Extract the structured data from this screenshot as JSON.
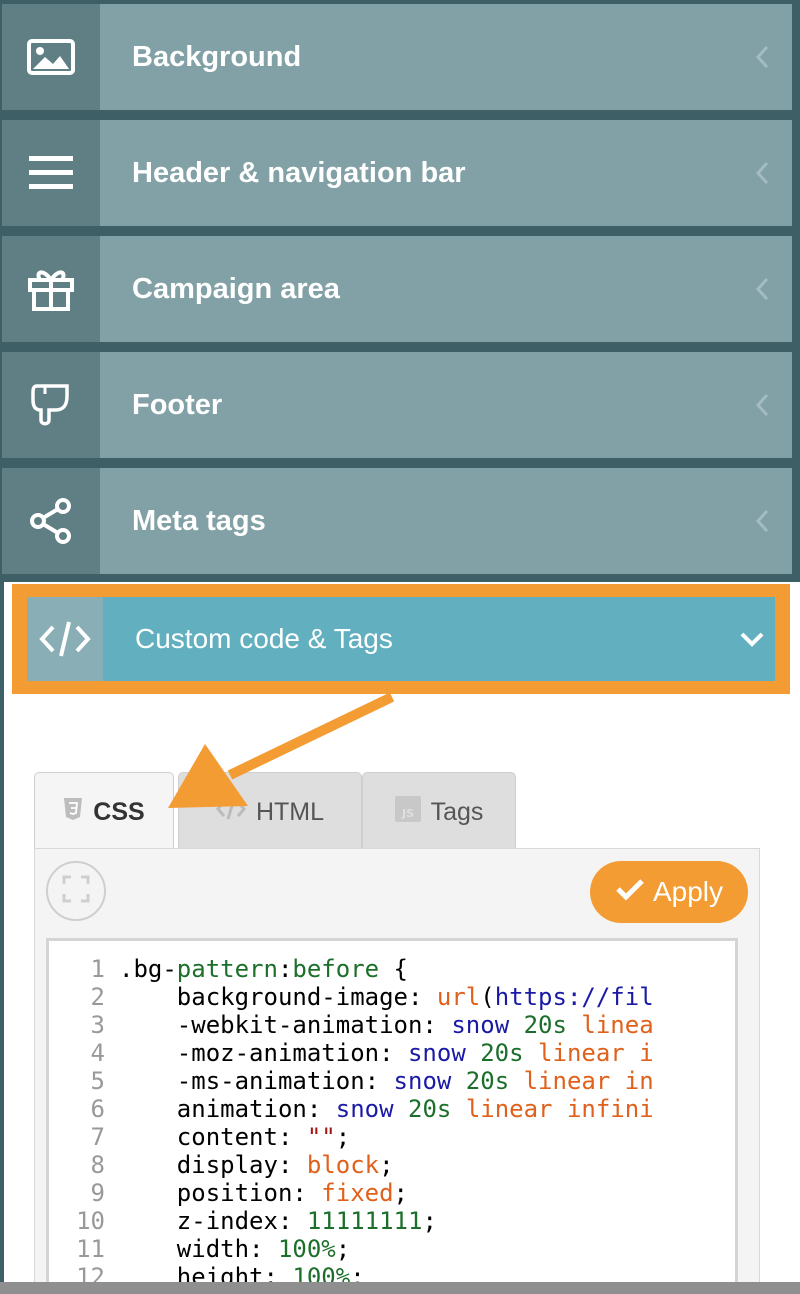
{
  "menu": [
    {
      "label": "Background",
      "icon": "image-icon"
    },
    {
      "label": "Header & navigation bar",
      "icon": "hamburger-icon"
    },
    {
      "label": "Campaign area",
      "icon": "gift-icon"
    },
    {
      "label": "Footer",
      "icon": "pointing-hand-icon"
    },
    {
      "label": "Meta tags",
      "icon": "share-icon"
    }
  ],
  "active": {
    "label": "Custom code & Tags",
    "icon": "code-icon"
  },
  "tabs": {
    "css": "CSS",
    "html": "HTML",
    "tags": "Tags"
  },
  "apply_label": "Apply",
  "code_lines": [
    {
      "n": "1",
      "parts": [
        [
          ".bg-",
          "k"
        ],
        [
          "pattern",
          "a"
        ],
        [
          ":",
          "k"
        ],
        [
          "before",
          "a"
        ],
        [
          " {",
          "k"
        ]
      ]
    },
    {
      "n": "2",
      "parts": [
        [
          "    background-image: ",
          "k"
        ],
        [
          "url",
          "o"
        ],
        [
          "(",
          "k"
        ],
        [
          "https",
          "v"
        ],
        [
          "://fil",
          "v"
        ]
      ]
    },
    {
      "n": "3",
      "parts": [
        [
          "    -webkit-animation: ",
          "k"
        ],
        [
          "snow",
          "v"
        ],
        [
          " ",
          "k"
        ],
        [
          "20s",
          "n"
        ],
        [
          " ",
          "k"
        ],
        [
          "linea",
          "o"
        ]
      ]
    },
    {
      "n": "4",
      "parts": [
        [
          "    -moz-animation: ",
          "k"
        ],
        [
          "snow",
          "v"
        ],
        [
          " ",
          "k"
        ],
        [
          "20s",
          "n"
        ],
        [
          " ",
          "k"
        ],
        [
          "linear i",
          "o"
        ]
      ]
    },
    {
      "n": "5",
      "parts": [
        [
          "    -ms-animation: ",
          "k"
        ],
        [
          "snow",
          "v"
        ],
        [
          " ",
          "k"
        ],
        [
          "20s",
          "n"
        ],
        [
          " ",
          "k"
        ],
        [
          "linear in",
          "o"
        ]
      ]
    },
    {
      "n": "6",
      "parts": [
        [
          "    animation: ",
          "k"
        ],
        [
          "snow",
          "v"
        ],
        [
          " ",
          "k"
        ],
        [
          "20s",
          "n"
        ],
        [
          " ",
          "k"
        ],
        [
          "linear infini",
          "o"
        ]
      ]
    },
    {
      "n": "7",
      "parts": [
        [
          "    content: ",
          "k"
        ],
        [
          "\"\"",
          "s"
        ],
        [
          ";",
          "k"
        ]
      ]
    },
    {
      "n": "8",
      "parts": [
        [
          "    display: ",
          "k"
        ],
        [
          "block",
          "o"
        ],
        [
          ";",
          "k"
        ]
      ]
    },
    {
      "n": "9",
      "parts": [
        [
          "    position: ",
          "k"
        ],
        [
          "fixed",
          "o"
        ],
        [
          ";",
          "k"
        ]
      ]
    },
    {
      "n": "10",
      "parts": [
        [
          "    z-index: ",
          "k"
        ],
        [
          "11111111",
          "n"
        ],
        [
          ";",
          "k"
        ]
      ]
    },
    {
      "n": "11",
      "parts": [
        [
          "    width: ",
          "k"
        ],
        [
          "100%",
          "n"
        ],
        [
          ";",
          "k"
        ]
      ]
    },
    {
      "n": "12",
      "parts": [
        [
          "    height: ",
          "k"
        ],
        [
          "100%",
          "n"
        ],
        [
          ";",
          "k"
        ]
      ]
    }
  ],
  "colors": {
    "accent": "#f39c34",
    "active_bg": "#62b0bf",
    "menu_bg": "#82a1a6"
  }
}
